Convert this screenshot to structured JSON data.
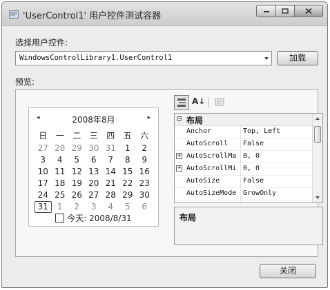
{
  "window": {
    "title": "'UserControl1' 用户控件测试容器"
  },
  "select_label": "选择用户控件:",
  "combo": {
    "value": "WindowsControlLibrary1.UserControl1"
  },
  "load_button": "加载",
  "preview_label": "预览:",
  "calendar": {
    "month_title": "2008年8月",
    "prev_glyph": "◂",
    "next_glyph": "▸",
    "weekdays": [
      "日",
      "一",
      "二",
      "三",
      "四",
      "五",
      "六"
    ],
    "weeks": [
      [
        "27",
        "28",
        "29",
        "30",
        "31",
        "1",
        "2"
      ],
      [
        "3",
        "4",
        "5",
        "6",
        "7",
        "8",
        "9"
      ],
      [
        "10",
        "11",
        "12",
        "13",
        "14",
        "15",
        "16"
      ],
      [
        "17",
        "18",
        "19",
        "20",
        "21",
        "22",
        "23"
      ],
      [
        "24",
        "25",
        "26",
        "27",
        "28",
        "29",
        "30"
      ],
      [
        "31",
        "1",
        "2",
        "3",
        "4",
        "5",
        "6"
      ]
    ],
    "other_month": [
      [
        true,
        true,
        true,
        true,
        true,
        false,
        false
      ],
      [
        false,
        false,
        false,
        false,
        false,
        false,
        false
      ],
      [
        false,
        false,
        false,
        false,
        false,
        false,
        false
      ],
      [
        false,
        false,
        false,
        false,
        false,
        false,
        false
      ],
      [
        false,
        false,
        false,
        false,
        false,
        false,
        false
      ],
      [
        false,
        true,
        true,
        true,
        true,
        true,
        true
      ]
    ],
    "today_label": "今天: 2008/8/31"
  },
  "property_grid": {
    "toolbar_icons": [
      "categorized-icon",
      "alphabetical-icon",
      "property-pages-icon"
    ],
    "alpha_glyph": "A↓",
    "rows": [
      {
        "kind": "category",
        "expander": "⊟",
        "label": "布局"
      },
      {
        "kind": "property",
        "expander": "",
        "name": "Anchor",
        "value": "Top, Left"
      },
      {
        "kind": "property",
        "expander": "",
        "name": "AutoScroll",
        "value": "False"
      },
      {
        "kind": "property",
        "expander": "+",
        "name": "AutoScrollMa",
        "value": "0, 0"
      },
      {
        "kind": "property",
        "expander": "+",
        "name": "AutoScrollMi",
        "value": "0, 0"
      },
      {
        "kind": "property",
        "expander": "",
        "name": "AutoSize",
        "value": "False"
      },
      {
        "kind": "property",
        "expander": "",
        "name": "AutoSizeMode",
        "value": "GrowOnly"
      }
    ],
    "description_title": "布局"
  },
  "close_button": "关闭"
}
